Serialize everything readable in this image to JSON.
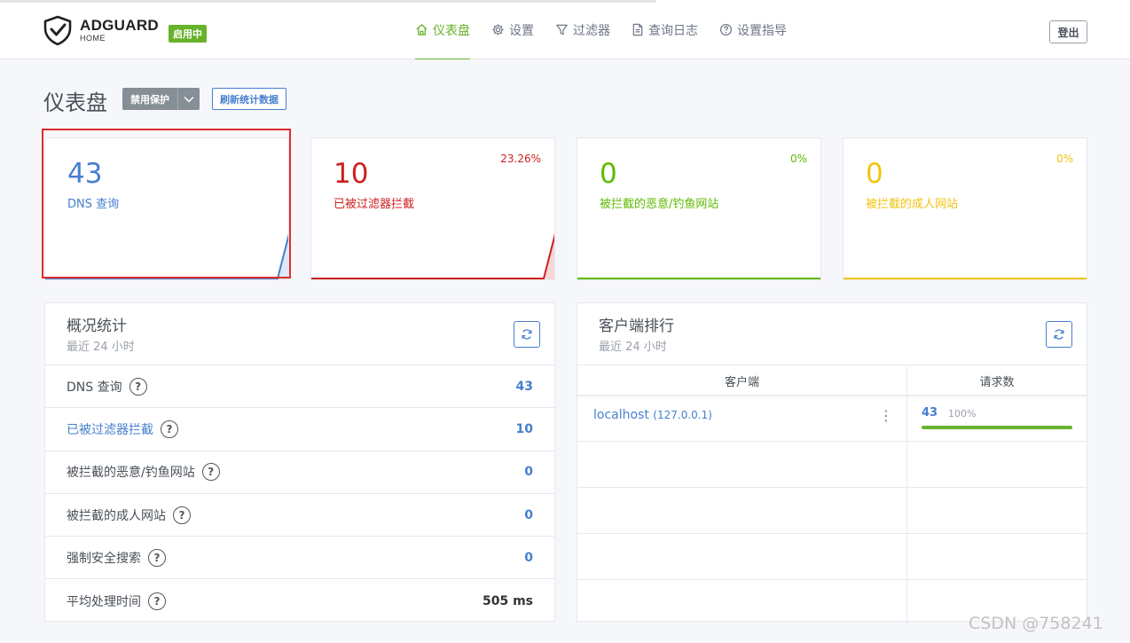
{
  "header": {
    "logo": {
      "name": "ADGUARD",
      "sub": "HOME"
    },
    "status_badge": "启用中",
    "nav": [
      {
        "label": "仪表盘",
        "icon": "home-icon",
        "active": true
      },
      {
        "label": "设置",
        "icon": "gear-icon",
        "active": false
      },
      {
        "label": "过滤器",
        "icon": "filter-icon",
        "active": false
      },
      {
        "label": "查询日志",
        "icon": "document-icon",
        "active": false
      },
      {
        "label": "设置指导",
        "icon": "help-circle-icon",
        "active": false
      }
    ],
    "logout_label": "登出"
  },
  "page": {
    "title": "仪表盘",
    "disable_protection_label": "禁用保护",
    "refresh_stats_label": "刷新统计数据"
  },
  "stat_cards": [
    {
      "value": "43",
      "label": "DNS 查询",
      "percent": "",
      "color": "#467fcf",
      "spark_rise": 0.85
    },
    {
      "value": "10",
      "label": "已被过滤器拦截",
      "percent": "23.26%",
      "color": "#cd201f",
      "spark_rise": 0.85
    },
    {
      "value": "0",
      "label": "被拦截的恶意/钓鱼网站",
      "percent": "0%",
      "color": "#5eba00",
      "spark_rise": 0
    },
    {
      "value": "0",
      "label": "被拦截的成人网站",
      "percent": "0%",
      "color": "#f1c40f",
      "spark_rise": 0
    }
  ],
  "overview": {
    "title": "概况统计",
    "subtitle": "最近 24 小时",
    "rows": [
      {
        "label": "DNS 查询",
        "value": "43",
        "link": false
      },
      {
        "label": "已被过滤器拦截",
        "value": "10",
        "link": true
      },
      {
        "label": "被拦截的恶意/钓鱼网站",
        "value": "0",
        "link": false
      },
      {
        "label": "被拦截的成人网站",
        "value": "0",
        "link": false
      },
      {
        "label": "强制安全搜索",
        "value": "0",
        "link": false
      },
      {
        "label": "平均处理时间",
        "value": "505 ms",
        "link": false
      }
    ]
  },
  "clients": {
    "title": "客户端排行",
    "subtitle": "最近 24 小时",
    "col_client": "客户端",
    "col_requests": "请求数",
    "rows": [
      {
        "name": "localhost",
        "ip": "(127.0.0.1)",
        "count": "43",
        "percent": "100%",
        "fraction": 1.0
      }
    ],
    "empty_rows": 4
  },
  "watermark": "CSDN @758241"
}
